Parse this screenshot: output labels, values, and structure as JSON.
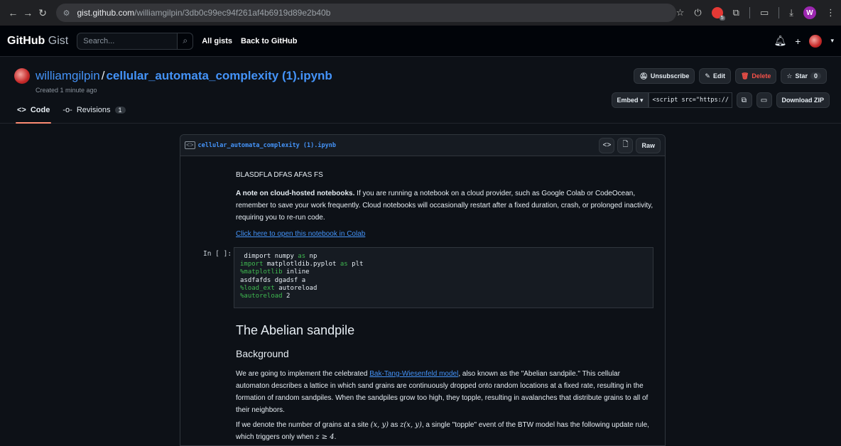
{
  "browser": {
    "url_host": "gist.github.com",
    "url_path": "/williamgilpin/3db0c99ec94f261af4b6919d89e2b40b",
    "extension_badge": "5",
    "profile_initial": "W"
  },
  "header": {
    "logo_bold": "GitHub",
    "logo_light": "Gist",
    "search_placeholder": "Search...",
    "links": [
      "All gists",
      "Back to GitHub"
    ]
  },
  "gist": {
    "owner": "williamgilpin",
    "filename": "cellular_automata_complexity (1).ipynb",
    "created": "Created 1 minute ago",
    "actions": {
      "unsubscribe": "Unsubscribe",
      "edit": "Edit",
      "delete": "Delete",
      "star": "Star",
      "star_count": "0"
    },
    "tabs": {
      "code": "Code",
      "revisions": "Revisions",
      "revisions_count": "1"
    },
    "embed": {
      "label": "Embed",
      "snippet": "<script src=\"https://",
      "download": "Download ZIP"
    }
  },
  "file": {
    "name": "cellular_automata_complexity (1).ipynb",
    "raw": "Raw"
  },
  "notebook": {
    "heading_text": "BLASDFLA DFAS AFAS FS",
    "note_bold": "A note on cloud-hosted notebooks.",
    "note_rest": " If you are running a notebook on a cloud provider, such as Google Colab or CodeOcean, remember to save your work frequently. Cloud notebooks will occasionally restart after a fixed duration, crash, or prolonged inactivity, requiring you to re-run code.",
    "colab_link": "Click here to open this notebook in Colab",
    "prompt": "In [ ]:",
    "code_lines": [
      " dimport numpy as np",
      "import matplotldib.pyplot as plt",
      "%matplotlib inline",
      "asdfafds dgadsf a",
      "%load_ext autoreload",
      "%autoreload 2"
    ],
    "h1": "The Abelian sandpile",
    "h2": "Background",
    "bg_pre": "We are going to implement the celebrated ",
    "bg_link": "Bak-Tang-Wiesenfeld model",
    "bg_post": ", also known as the \"Abelian sandpile.\" This cellular automaton describes a lattice in which sand grains are continuously dropped onto random locations at a fixed rate, resulting in the formation of random sandpiles. When the sandpiles grow too high, they topple, resulting in avalanches that distribute grains to all of their neighbors.",
    "p2_a": "If we denote the number of grains at a site ",
    "p2_m1": "(x, y)",
    "p2_b": " as ",
    "p2_m2": "z(x, y)",
    "p2_c": ", a single \"topple\" event of the BTW model has the following update rule, which triggers only when ",
    "p2_m3": "z ≥ 4",
    "p2_d": "."
  }
}
